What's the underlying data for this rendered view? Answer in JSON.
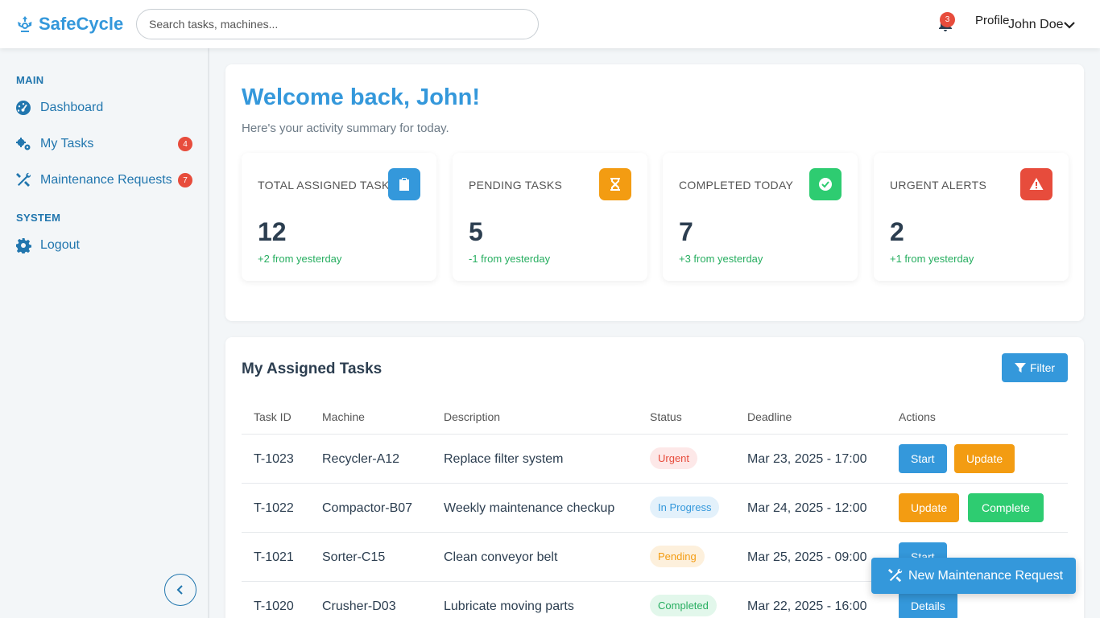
{
  "header": {
    "brand": "SafeCycle",
    "search_placeholder": "Search tasks, machines...",
    "notification_count": "3",
    "profile_label": "Profile",
    "user_name": "John Doe"
  },
  "sidebar": {
    "sections": [
      {
        "label": "MAIN"
      },
      {
        "label": "SYSTEM"
      }
    ],
    "items": [
      {
        "label": "Dashboard",
        "icon": "gauge-icon"
      },
      {
        "label": "My Tasks",
        "icon": "gears-icon",
        "badge": "4"
      },
      {
        "label": "Maintenance Requests",
        "icon": "tools-icon",
        "badge": "7"
      },
      {
        "label": "Logout",
        "icon": "gear-icon"
      }
    ]
  },
  "welcome": {
    "title": "Welcome back, John!",
    "subtitle": "Here's your activity summary for today."
  },
  "stats": [
    {
      "label": "TOTAL ASSIGNED TASKS",
      "value": "12",
      "change": "+2 from yesterday",
      "icon": "clipboard-icon",
      "color": "#3498db"
    },
    {
      "label": "PENDING TASKS",
      "value": "5",
      "change": "-1 from yesterday",
      "icon": "hourglass-icon",
      "color": "#f39c12"
    },
    {
      "label": "COMPLETED TODAY",
      "value": "7",
      "change": "+3 from yesterday",
      "icon": "check-circle-icon",
      "color": "#2ecc71"
    },
    {
      "label": "URGENT ALERTS",
      "value": "2",
      "change": "+1 from yesterday",
      "icon": "warning-icon",
      "color": "#e74c3c"
    }
  ],
  "tasks": {
    "title": "My Assigned Tasks",
    "filter_label": "Filter",
    "columns": [
      "Task ID",
      "Machine",
      "Description",
      "Status",
      "Deadline",
      "Actions"
    ],
    "rows": [
      {
        "id": "T-1023",
        "machine": "Recycler-A12",
        "description": "Replace filter system",
        "status": "Urgent",
        "deadline": "Mar 23, 2025 - 17:00",
        "actions": [
          "Start",
          "Update"
        ]
      },
      {
        "id": "T-1022",
        "machine": "Compactor-B07",
        "description": "Weekly maintenance checkup",
        "status": "In Progress",
        "deadline": "Mar 24, 2025 - 12:00",
        "actions": [
          "Update",
          "Complete"
        ]
      },
      {
        "id": "T-1021",
        "machine": "Sorter-C15",
        "description": "Clean conveyor belt",
        "status": "Pending",
        "deadline": "Mar 25, 2025 - 09:00",
        "actions": [
          "Start"
        ]
      },
      {
        "id": "T-1020",
        "machine": "Crusher-D03",
        "description": "Lubricate moving parts",
        "status": "Completed",
        "deadline": "Mar 22, 2025 - 16:00",
        "actions": [
          "Details"
        ]
      }
    ]
  },
  "fab": {
    "label": "New Maintenance Request"
  },
  "colors": {
    "accent": "#3498db",
    "urgent": "#e74c3c",
    "pending": "#f39c12",
    "success": "#2ecc71"
  }
}
